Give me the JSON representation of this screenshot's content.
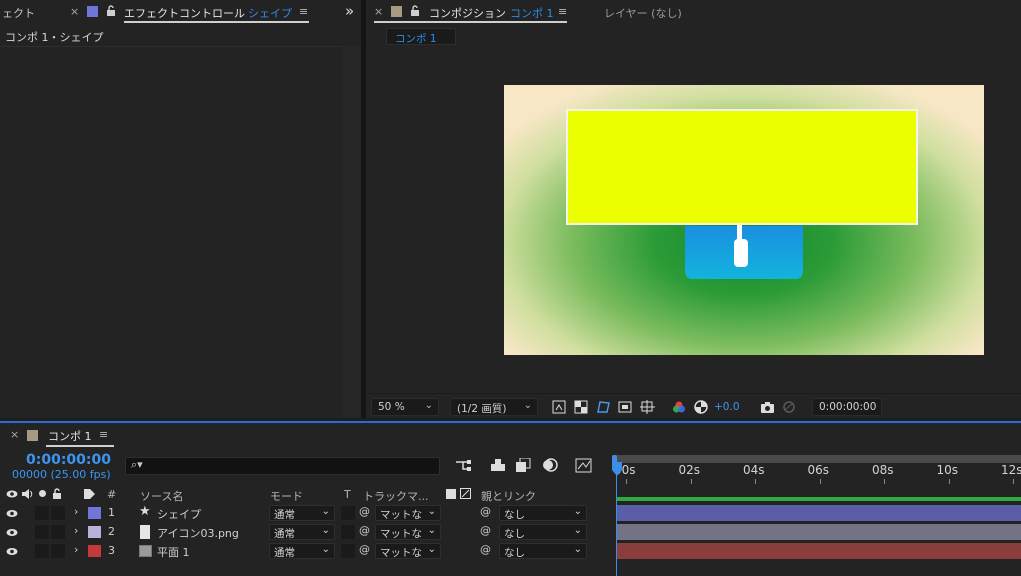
{
  "left_panel": {
    "prev_tab_label": "ェクト",
    "tab_close": "×",
    "tab_title": "エフェクトコントロール",
    "tab_target": "シェイプ",
    "menu_glyph": "≡",
    "expand_glyph": "»",
    "subheader": "コンポ 1・シェイプ",
    "swatch_color": "#6f76d6"
  },
  "comp_panel": {
    "tab_close": "×",
    "tab_title": "コンポジション",
    "tab_target": "コンポ 1",
    "menu_glyph": "≡",
    "layer_tab": "レイヤー (なし)",
    "breadcrumb": "コンポ 1",
    "swatch_color": "#a89a82"
  },
  "viewer_toolbar": {
    "zoom": "50 %",
    "resolution": "(1/2 画質)",
    "exposure": "+0.0",
    "timecode": "0:00:00:00"
  },
  "timeline": {
    "tab_close": "×",
    "tab_title": "コンポ 1",
    "menu_glyph": "≡",
    "swatch_color": "#a89a82",
    "current_time": "0:00:00:00",
    "frame_info": "00000 (25.00 fps)",
    "search_glyph": "⌕▾",
    "columns": {
      "num": "#",
      "source_name": "ソース名",
      "mode": "モード",
      "t": "T",
      "track_matte": "トラックマ...",
      "parent": "親とリンク"
    },
    "ruler": [
      "00s",
      "02s",
      "04s",
      "06s",
      "08s",
      "10s",
      "12s"
    ],
    "layers": [
      {
        "num": "1",
        "name": "シェイプ",
        "label_color": "#6f76d6",
        "mode": "通常",
        "matte": "マットな",
        "parent": "なし",
        "bar_color": "#5a5ea8",
        "type": "shape"
      },
      {
        "num": "2",
        "name": "アイコン03.png",
        "label_color": "#b7b3d8",
        "mode": "通常",
        "matte": "マットな",
        "parent": "なし",
        "bar_color": "#747386",
        "type": "file"
      },
      {
        "num": "3",
        "name": "平面 1",
        "label_color": "#c23a3a",
        "mode": "通常",
        "matte": "マットな",
        "parent": "なし",
        "bar_color": "#8a3d3d",
        "type": "solid"
      }
    ]
  }
}
